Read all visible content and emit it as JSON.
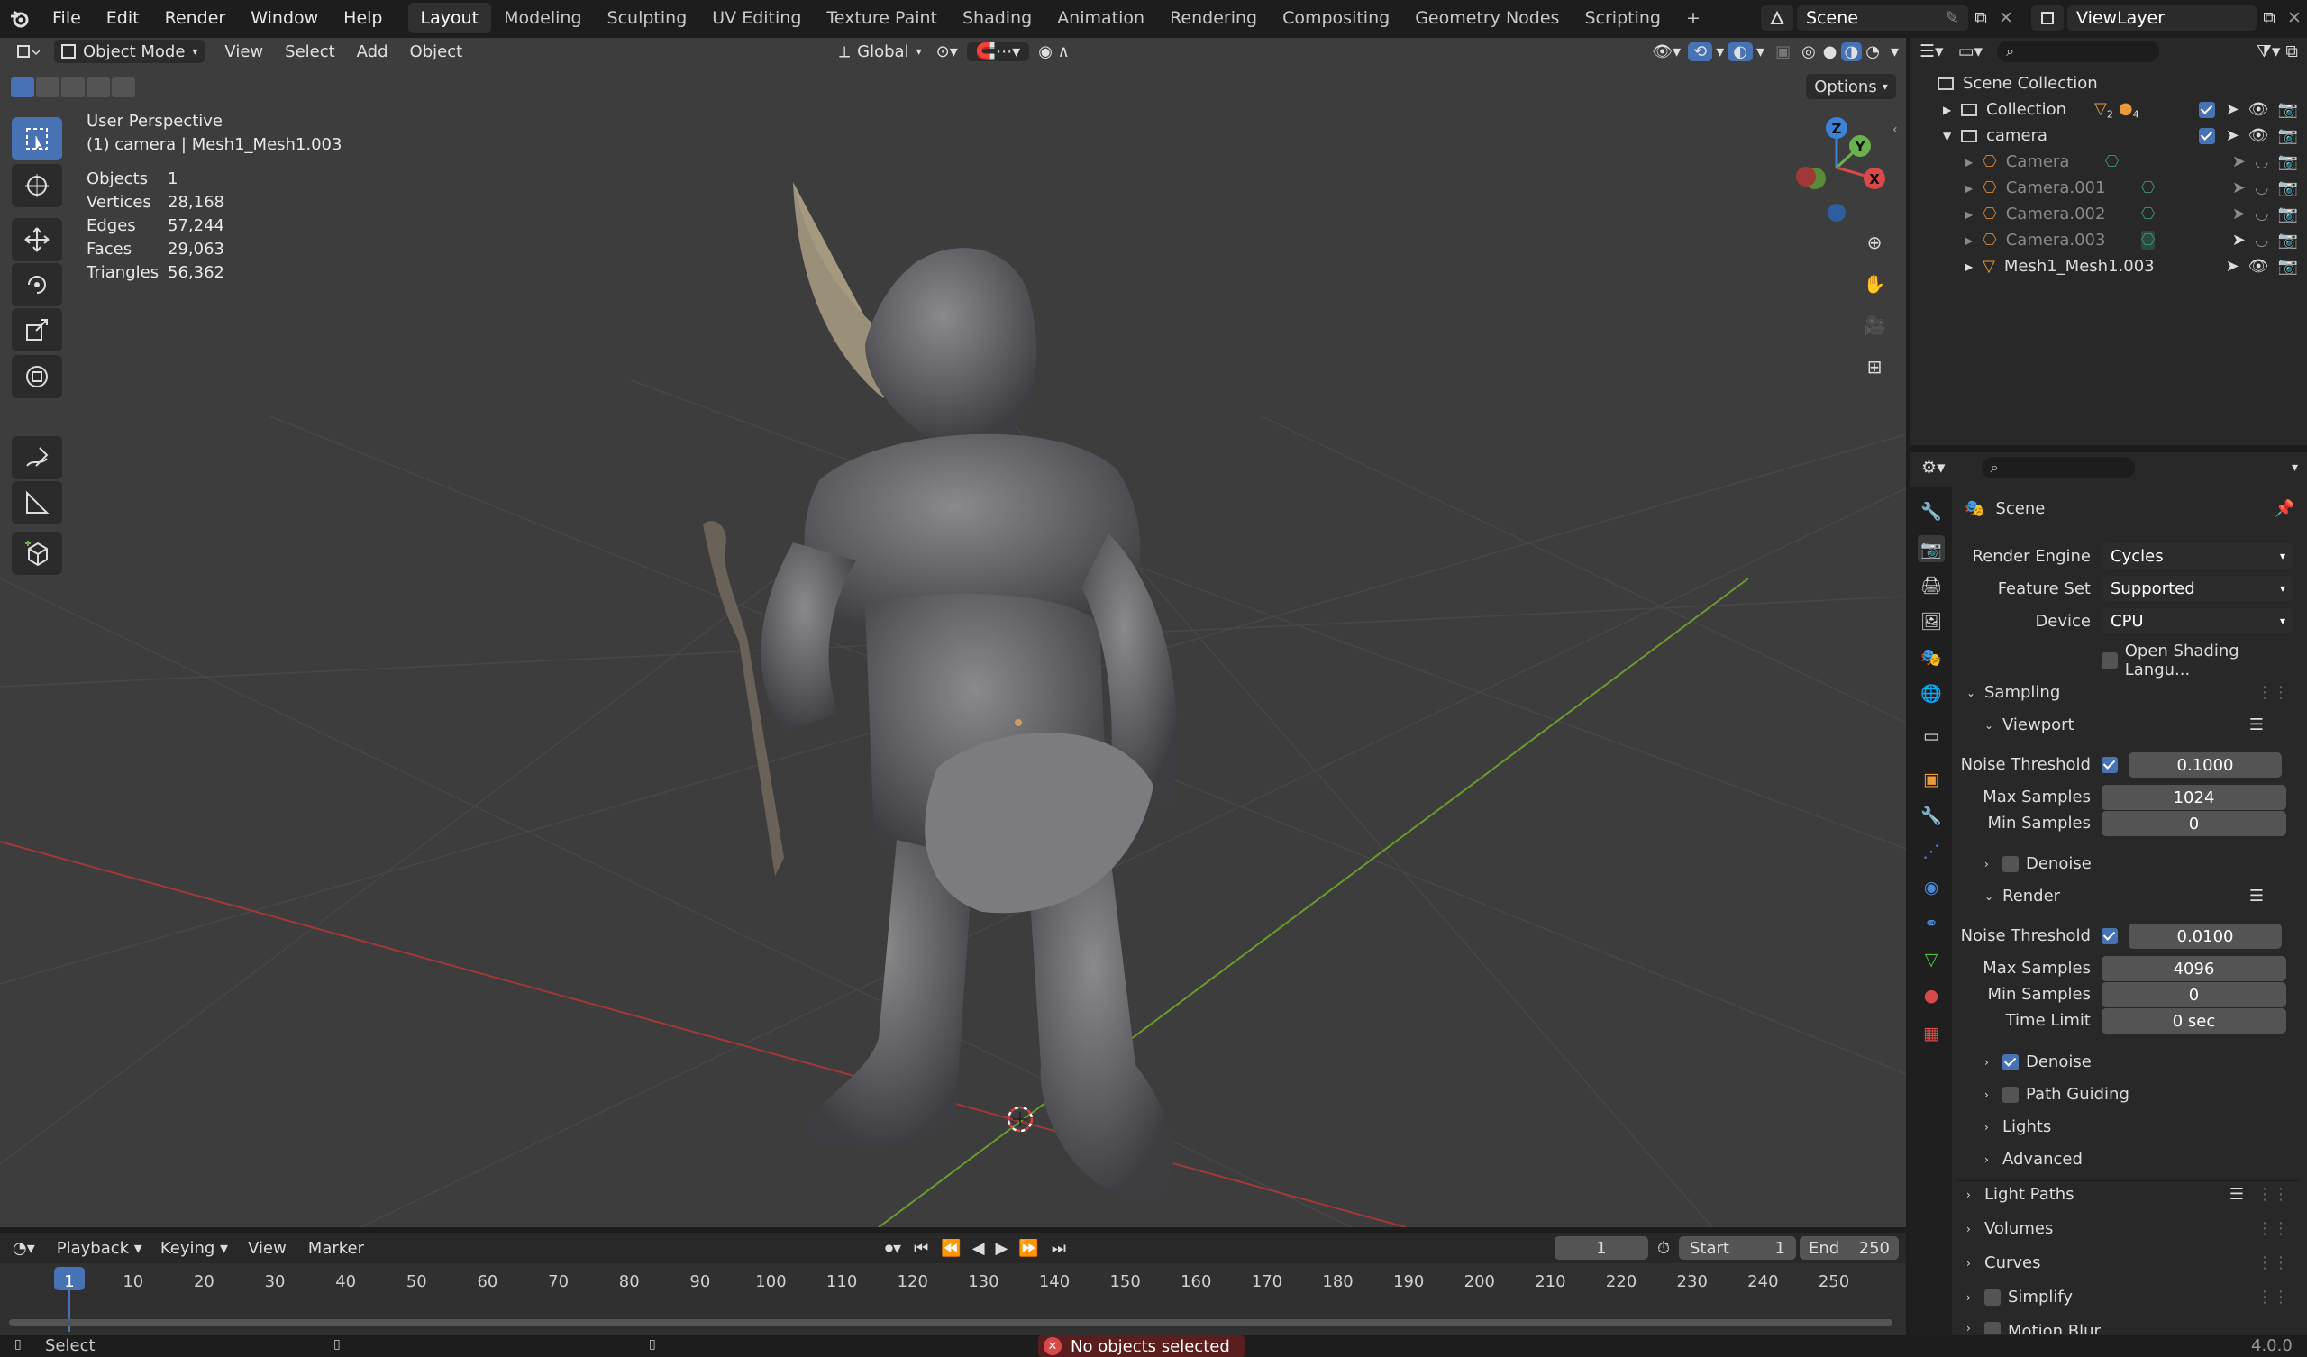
{
  "topbar": {
    "menus": [
      "File",
      "Edit",
      "Render",
      "Window",
      "Help"
    ],
    "workspaces": [
      "Layout",
      "Modeling",
      "Sculpting",
      "UV Editing",
      "Texture Paint",
      "Shading",
      "Animation",
      "Rendering",
      "Compositing",
      "Geometry Nodes",
      "Scripting"
    ],
    "active_workspace": "Layout",
    "add_symbol": "+",
    "scene": "Scene",
    "view_layer": "ViewLayer"
  },
  "viewport": {
    "mode": "Object Mode",
    "menus": [
      "View",
      "Select",
      "Add",
      "Object"
    ],
    "orientation": "Global",
    "options": "Options",
    "perspective": "User Perspective",
    "context": "(1) camera | Mesh1_Mesh1.003",
    "stats": [
      {
        "label": "Objects",
        "value": "1"
      },
      {
        "label": "Vertices",
        "value": "28,168"
      },
      {
        "label": "Edges",
        "value": "57,244"
      },
      {
        "label": "Faces",
        "value": "29,063"
      },
      {
        "label": "Triangles",
        "value": "56,362"
      }
    ],
    "gizmo": {
      "z": "Z",
      "y": "Y",
      "x": "X"
    }
  },
  "outliner": {
    "root": "Scene Collection",
    "collection": "Collection",
    "collection_badges": [
      "2",
      "4"
    ],
    "camera_collection": "camera",
    "items": [
      "Camera",
      "Camera.001",
      "Camera.002",
      "Camera.003",
      "Mesh1_Mesh1.003"
    ]
  },
  "properties": {
    "title": "Scene",
    "render_engine_label": "Render Engine",
    "render_engine": "Cycles",
    "feature_set_label": "Feature Set",
    "feature_set": "Supported",
    "device_label": "Device",
    "device": "CPU",
    "osl": "Open Shading Langu...",
    "sampling": "Sampling",
    "viewport": "Viewport",
    "noise_threshold_label": "Noise Threshold",
    "vp_noise": "0.1000",
    "max_samples_label": "Max Samples",
    "vp_max": "1024",
    "min_samples_label": "Min Samples",
    "vp_min": "0",
    "denoise": "Denoise",
    "render": "Render",
    "r_noise": "0.0100",
    "r_max": "4096",
    "r_min": "0",
    "time_limit_label": "Time Limit",
    "time_limit": "0 sec",
    "path_guiding": "Path Guiding",
    "lights": "Lights",
    "advanced": "Advanced",
    "light_paths": "Light Paths",
    "volumes": "Volumes",
    "curves": "Curves",
    "simplify": "Simplify",
    "motion_blur": "Motion Blur"
  },
  "timeline": {
    "menus": [
      "Playback",
      "Keying",
      "View",
      "Marker"
    ],
    "current_frame": "1",
    "start_label": "Start",
    "start": "1",
    "end_label": "End",
    "end": "250",
    "ticks": [
      "1",
      "10",
      "20",
      "30",
      "40",
      "50",
      "60",
      "70",
      "80",
      "90",
      "100",
      "110",
      "120",
      "130",
      "140",
      "150",
      "160",
      "170",
      "180",
      "190",
      "200",
      "210",
      "220",
      "230",
      "240",
      "250"
    ]
  },
  "status": {
    "left": "Select",
    "message": "No objects selected",
    "version": "4.0.0"
  }
}
